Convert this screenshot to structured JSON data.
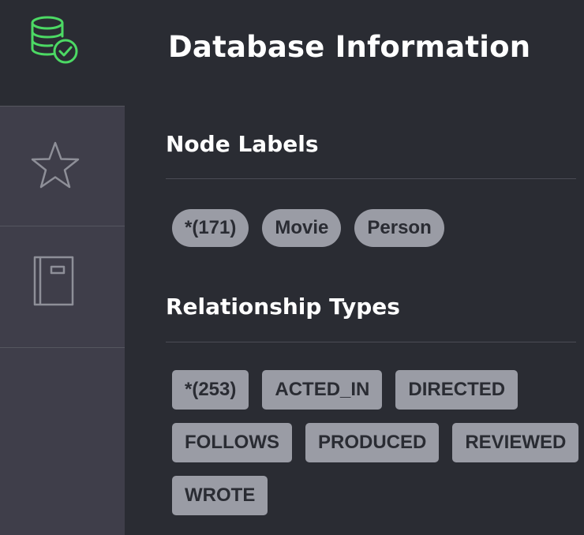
{
  "sidebar": {
    "items": [
      {
        "name": "database",
        "icon": "database-check-icon",
        "active": true,
        "color": "#4cd964"
      },
      {
        "name": "favorites",
        "icon": "star-icon",
        "active": false
      },
      {
        "name": "documents",
        "icon": "book-icon",
        "active": false
      }
    ]
  },
  "drawer": {
    "title": "Database Information",
    "node_labels": {
      "heading": "Node Labels",
      "items": [
        "*(171)",
        "Movie",
        "Person"
      ]
    },
    "relationship_types": {
      "heading": "Relationship Types",
      "items": [
        "*(253)",
        "ACTED_IN",
        "DIRECTED",
        "FOLLOWS",
        "PRODUCED",
        "REVIEWED",
        "WROTE"
      ]
    }
  },
  "colors": {
    "background": "#2a2c33",
    "rail": "#3f3e4a",
    "accent_green": "#4cd964",
    "tag_bg": "#9a9ca5",
    "tag_text": "#2a2c33"
  }
}
